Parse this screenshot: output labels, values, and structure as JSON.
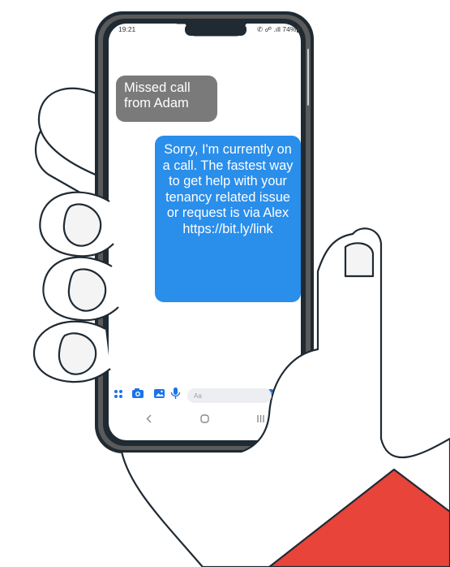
{
  "status_bar": {
    "time": "19:21",
    "indicators": "✆ ☍ .ıll 74%▮",
    "battery_percent": 74
  },
  "messages": [
    {
      "direction": "incoming",
      "text": "Missed call from Adam"
    },
    {
      "direction": "outgoing",
      "text": "Sorry, I'm currently on a call. The fastest way to get help with your tenancy related issue or request is via Alex https://bit.ly/link"
    }
  ],
  "composer": {
    "placeholder": "Aa",
    "icons": [
      "apps-icon",
      "camera-icon",
      "gallery-icon",
      "mic-icon",
      "emoji-icon"
    ]
  },
  "nav_bar": {
    "icons": [
      "back-icon",
      "home-icon",
      "recents-icon"
    ]
  },
  "colors": {
    "incoming_bubble": "#7a7a7a",
    "outgoing_bubble": "#2a8eeb",
    "accent": "#1a73e8",
    "sleeve": "#e8443a",
    "outline": "#1f2a33",
    "phone_frame": "#4a4a4a"
  }
}
